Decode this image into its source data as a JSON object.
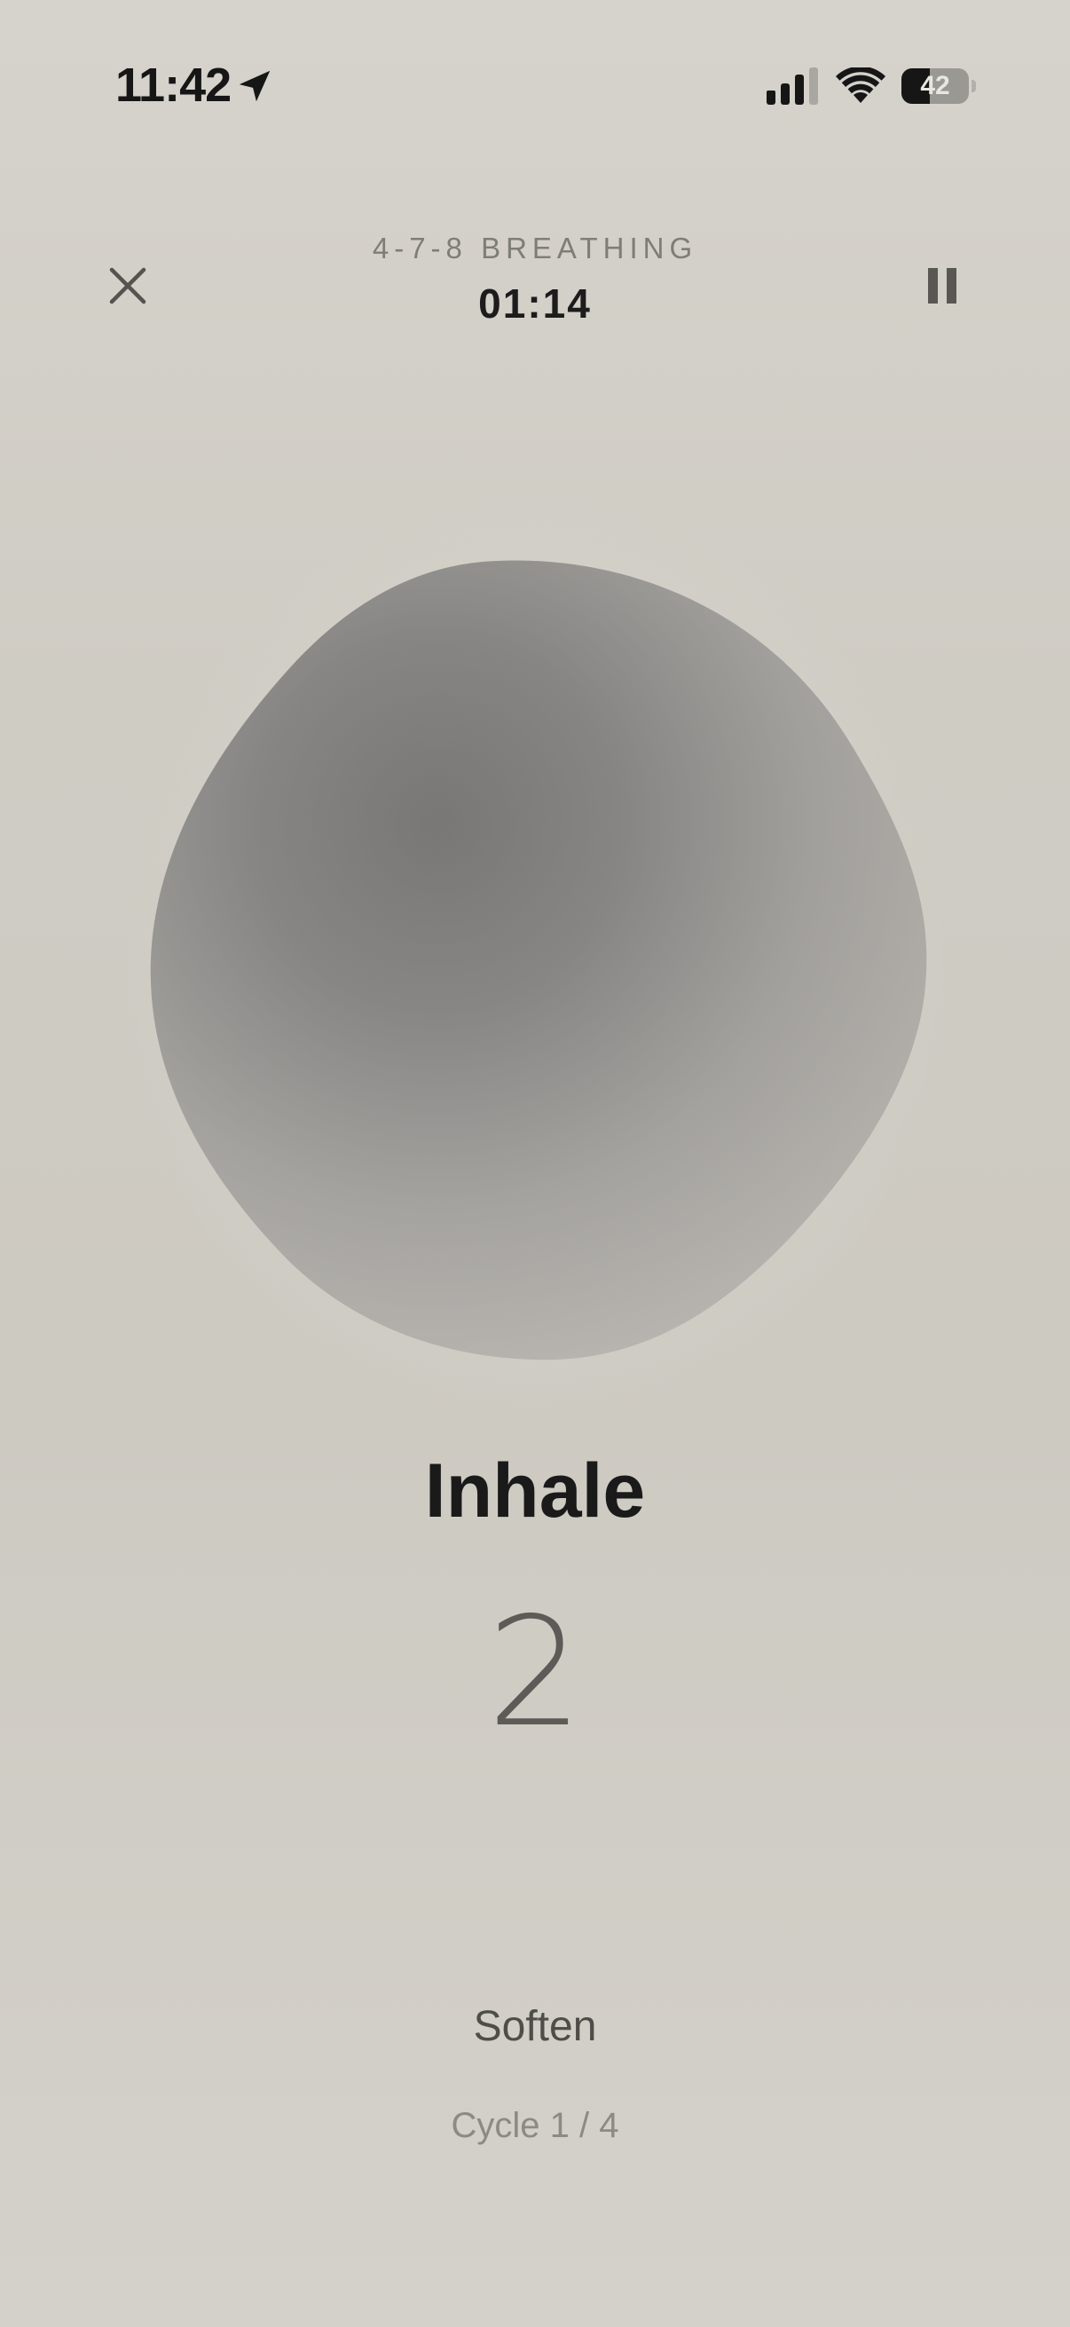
{
  "status_bar": {
    "time": "11:42",
    "battery_level": "42",
    "battery_fraction": 0.42,
    "icons": [
      "location-arrow-icon",
      "cellular-signal-icon",
      "wifi-icon",
      "battery-icon"
    ]
  },
  "header": {
    "exercise_name": "4-7-8 BREATHING",
    "elapsed": "01:14",
    "close_icon": "close-icon",
    "pause_icon": "pause-icon"
  },
  "session": {
    "phase": "Inhale",
    "count": "2",
    "cue": "Soften",
    "cycle": "Cycle 1 / 4"
  },
  "colors": {
    "background": "#cfccc5",
    "orb_core": "#7c7b78",
    "orb_edge": "#b3b0aa",
    "text_primary": "#1a1a1a",
    "text_muted": "#8c8a85"
  }
}
